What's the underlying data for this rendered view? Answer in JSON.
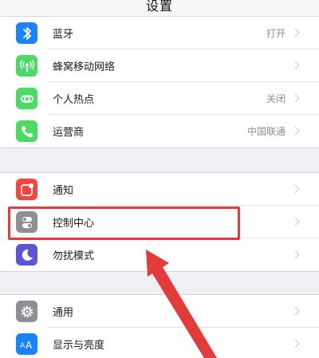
{
  "nav": {
    "title": "设置"
  },
  "group1": [
    {
      "label": "蓝牙",
      "detail": "打开",
      "icon": "bluetooth-icon",
      "color": "#1a82fb"
    },
    {
      "label": "蜂窝移动网络",
      "detail": "",
      "icon": "cellular-icon",
      "color": "#4cd964"
    },
    {
      "label": "个人热点",
      "detail": "关闭",
      "icon": "hotspot-icon",
      "color": "#4cd964"
    },
    {
      "label": "运营商",
      "detail": "中国联通",
      "icon": "phone-icon",
      "color": "#4cd964"
    }
  ],
  "group2": [
    {
      "label": "通知",
      "detail": "",
      "icon": "notifications-icon",
      "color": "#f2453d"
    },
    {
      "label": "控制中心",
      "detail": "",
      "icon": "control-center-icon",
      "color": "#8e8e93"
    },
    {
      "label": "勿扰模式",
      "detail": "",
      "icon": "moon-icon",
      "color": "#5856d6"
    }
  ],
  "group3": [
    {
      "label": "通用",
      "detail": "",
      "icon": "gear-icon",
      "color": "#8e8e93"
    },
    {
      "label": "显示与亮度",
      "detail": "",
      "icon": "display-brightness-icon",
      "color": "#1a82fb"
    }
  ],
  "annotation": {
    "color": "#e33a3a"
  }
}
